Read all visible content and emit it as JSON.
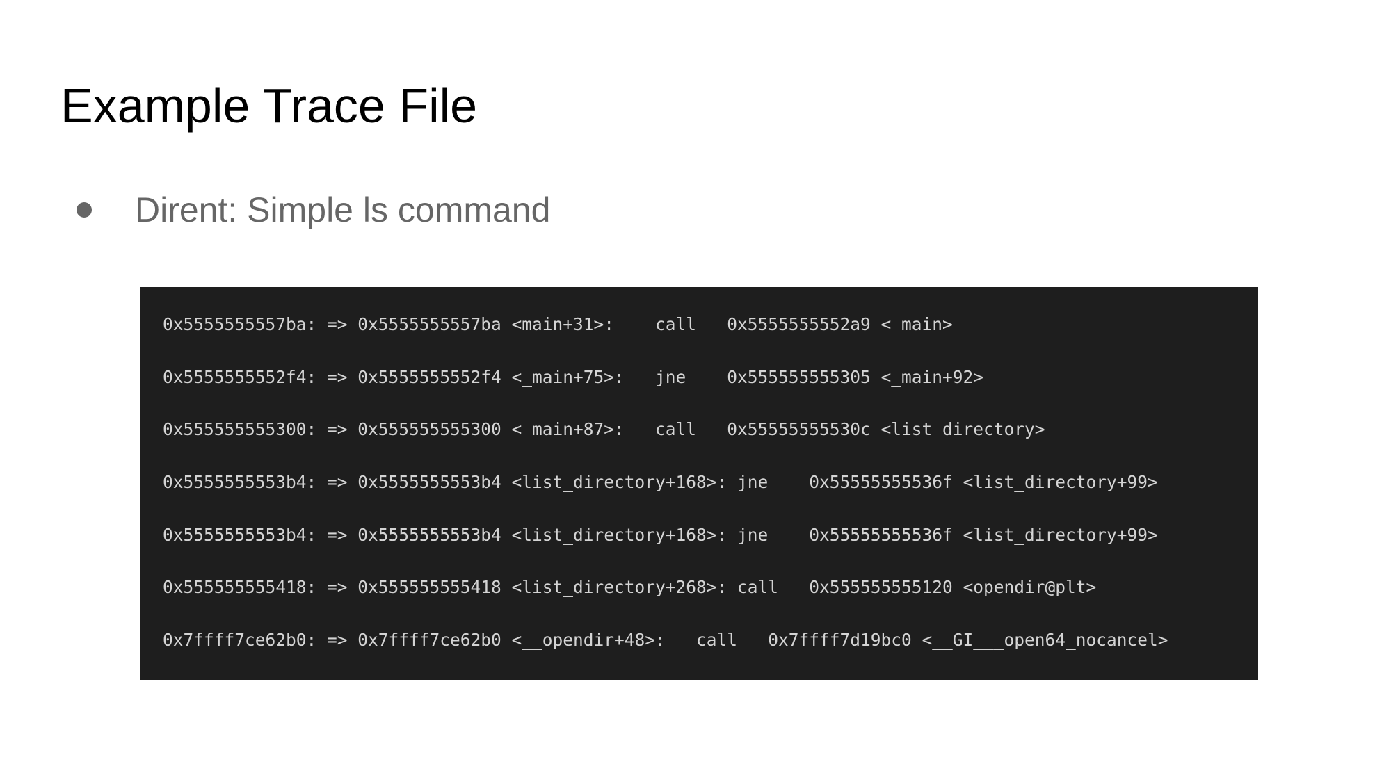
{
  "slide": {
    "title": "Example Trace File",
    "bullets": [
      {
        "text": "Dirent: Simple ls command"
      }
    ]
  },
  "terminal": {
    "lines": [
      "0x5555555557ba: => 0x5555555557ba <main+31>:    call   0x5555555552a9 <_main>",
      "0x5555555552f4: => 0x5555555552f4 <_main+75>:   jne    0x555555555305 <_main+92>",
      "0x555555555300: => 0x555555555300 <_main+87>:   call   0x55555555530c <list_directory>",
      "0x5555555553b4: => 0x5555555553b4 <list_directory+168>: jne    0x55555555536f <list_directory+99>",
      "0x5555555553b4: => 0x5555555553b4 <list_directory+168>: jne    0x55555555536f <list_directory+99>",
      "0x555555555418: => 0x555555555418 <list_directory+268>: call   0x555555555120 <opendir@plt>",
      "0x7ffff7ce62b0: => 0x7ffff7ce62b0 <__opendir+48>:   call   0x7ffff7d19bc0 <__GI___open64_nocancel>"
    ]
  }
}
